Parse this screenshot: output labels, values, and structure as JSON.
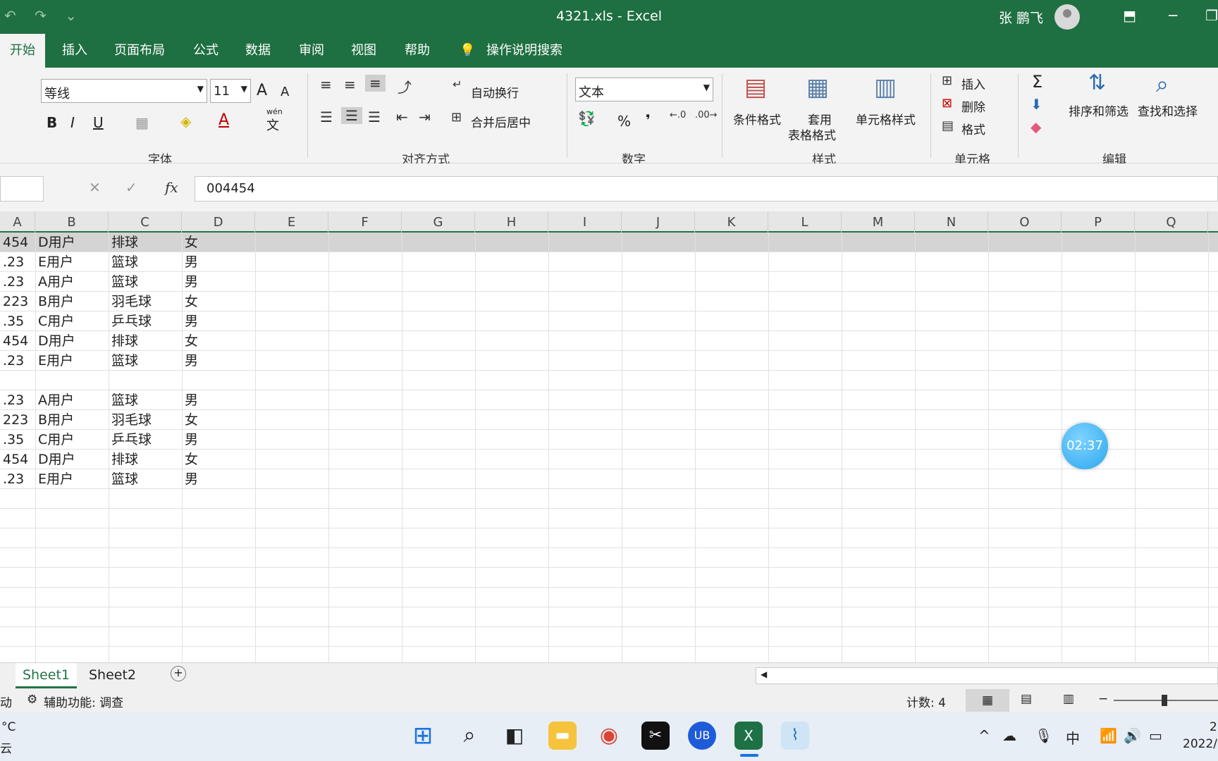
{
  "window": {
    "title": "4321.xls  -  Excel",
    "user": "张 鹏飞",
    "minimize": "─",
    "restore": "❐",
    "mode_icon": "⬒"
  },
  "tabs": [
    "开始",
    "插入",
    "页面布局",
    "公式",
    "数据",
    "审阅",
    "视图",
    "帮助",
    "操作说明搜索"
  ],
  "ribbon": {
    "font_name": "等线",
    "font_size": "11",
    "grow_font": "A",
    "shrink_font": "A",
    "bold": "B",
    "italic": "I",
    "underline": "U",
    "wen": "wén",
    "wen_char": "文",
    "wrap_text": "自动换行",
    "merge_center": "合并后居中",
    "number_format": "文本",
    "percent": "%",
    "comma": "❜",
    "cond_format": "条件格式",
    "table_format_1": "套用",
    "table_format_2": "表格格式",
    "cell_style": "单元格样式",
    "insert": "插入",
    "delete": "删除",
    "format": "格式",
    "sort_filter": "排序和筛选",
    "find_select": "查找和选择",
    "group_font": "字体",
    "group_align": "对齐方式",
    "group_number": "数字",
    "group_style": "样式",
    "group_cells": "单元格",
    "group_edit": "编辑",
    "sigma": "Σ"
  },
  "formula_bar": {
    "value": "004454",
    "fx": "fx",
    "cancel": "✕",
    "confirm": "✓"
  },
  "columns": [
    "A",
    "B",
    "C",
    "D",
    "E",
    "F",
    "G",
    "H",
    "I",
    "J",
    "K",
    "L",
    "M",
    "N",
    "O",
    "P",
    "Q"
  ],
  "rows": [
    [
      "454",
      "D用户",
      "排球",
      "女"
    ],
    [
      ".23",
      "E用户",
      "篮球",
      "男"
    ],
    [
      ".23",
      "A用户",
      "篮球",
      "男"
    ],
    [
      "223",
      "B用户",
      "羽毛球",
      "女"
    ],
    [
      ".35",
      "C用户",
      "乒乓球",
      "男"
    ],
    [
      "454",
      "D用户",
      "排球",
      "女"
    ],
    [
      ".23",
      "E用户",
      "篮球",
      "男"
    ],
    [
      "",
      "",
      "",
      ""
    ],
    [
      ".23",
      "A用户",
      "篮球",
      "男"
    ],
    [
      "223",
      "B用户",
      "羽毛球",
      "女"
    ],
    [
      ".35",
      "C用户",
      "乒乓球",
      "男"
    ],
    [
      "454",
      "D用户",
      "排球",
      "女"
    ],
    [
      ".23",
      "E用户",
      "篮球",
      "男"
    ]
  ],
  "timer": "02:37",
  "sheets": [
    "Sheet1",
    "Sheet2"
  ],
  "add_sheet": "+",
  "status": {
    "mode": "动",
    "accessibility": "辅助功能: 调查",
    "count": "计数: 4"
  },
  "taskbar": {
    "weather_temp": "°C",
    "weather_desc": "云",
    "ime": "中",
    "clock_time": "2",
    "clock_date": "2022/"
  }
}
